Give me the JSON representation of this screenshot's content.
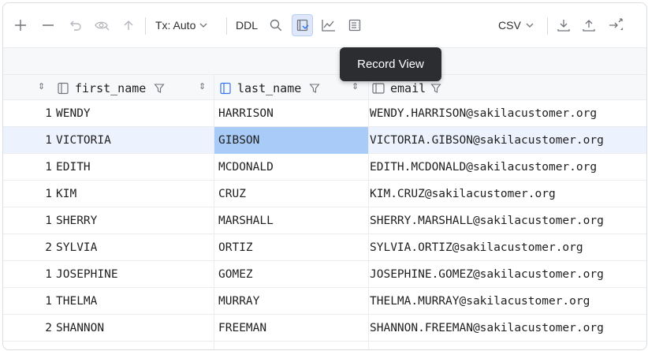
{
  "toolbar": {
    "tx_label": "Tx: Auto",
    "ddl_label": "DDL",
    "export_format": "CSV",
    "icons": [
      "add-row-icon",
      "delete-row-icon",
      "revert-icon",
      "preview-icon",
      "submit-icon",
      "tx-dropdown-icon",
      "search-icon",
      "record-view-icon",
      "chart-icon",
      "text-view-icon",
      "csv-dropdown-icon",
      "download-icon",
      "upload-icon",
      "compare-icon"
    ]
  },
  "tooltip": {
    "text": "Record View"
  },
  "columns": [
    {
      "name": "first_name",
      "icon": "column-icon",
      "filter_icon": "filter-icon"
    },
    {
      "name": "last_name",
      "icon": "column-icon",
      "filter_icon": "filter-icon"
    },
    {
      "name": "email",
      "icon": "column-icon",
      "filter_icon": "filter-icon"
    }
  ],
  "rows": [
    {
      "count": "1",
      "first_name": "WENDY",
      "last_name": "HARRISON",
      "email": "WENDY.HARRISON@sakilacustomer.org"
    },
    {
      "count": "1",
      "first_name": "VICTORIA",
      "last_name": "GIBSON",
      "email": "VICTORIA.GIBSON@sakilacustomer.org"
    },
    {
      "count": "1",
      "first_name": "EDITH",
      "last_name": "MCDONALD",
      "email": "EDITH.MCDONALD@sakilacustomer.org"
    },
    {
      "count": "1",
      "first_name": "KIM",
      "last_name": "CRUZ",
      "email": "KIM.CRUZ@sakilacustomer.org"
    },
    {
      "count": "1",
      "first_name": "SHERRY",
      "last_name": "MARSHALL",
      "email": "SHERRY.MARSHALL@sakilacustomer.org"
    },
    {
      "count": "2",
      "first_name": "SYLVIA",
      "last_name": "ORTIZ",
      "email": "SYLVIA.ORTIZ@sakilacustomer.org"
    },
    {
      "count": "1",
      "first_name": "JOSEPHINE",
      "last_name": "GOMEZ",
      "email": "JOSEPHINE.GOMEZ@sakilacustomer.org"
    },
    {
      "count": "1",
      "first_name": "THELMA",
      "last_name": "MURRAY",
      "email": "THELMA.MURRAY@sakilacustomer.org"
    },
    {
      "count": "2",
      "first_name": "SHANNON",
      "last_name": "FREEMAN",
      "email": "SHANNON.FREEMAN@sakilacustomer.org"
    }
  ],
  "selected_row": 1,
  "selected_cell": "last_name",
  "colors": {
    "selection": "#a9cbf7",
    "row_highlight": "#edf3fe",
    "active_button": "#dfe8fb",
    "tooltip_bg": "#2b2d30"
  }
}
